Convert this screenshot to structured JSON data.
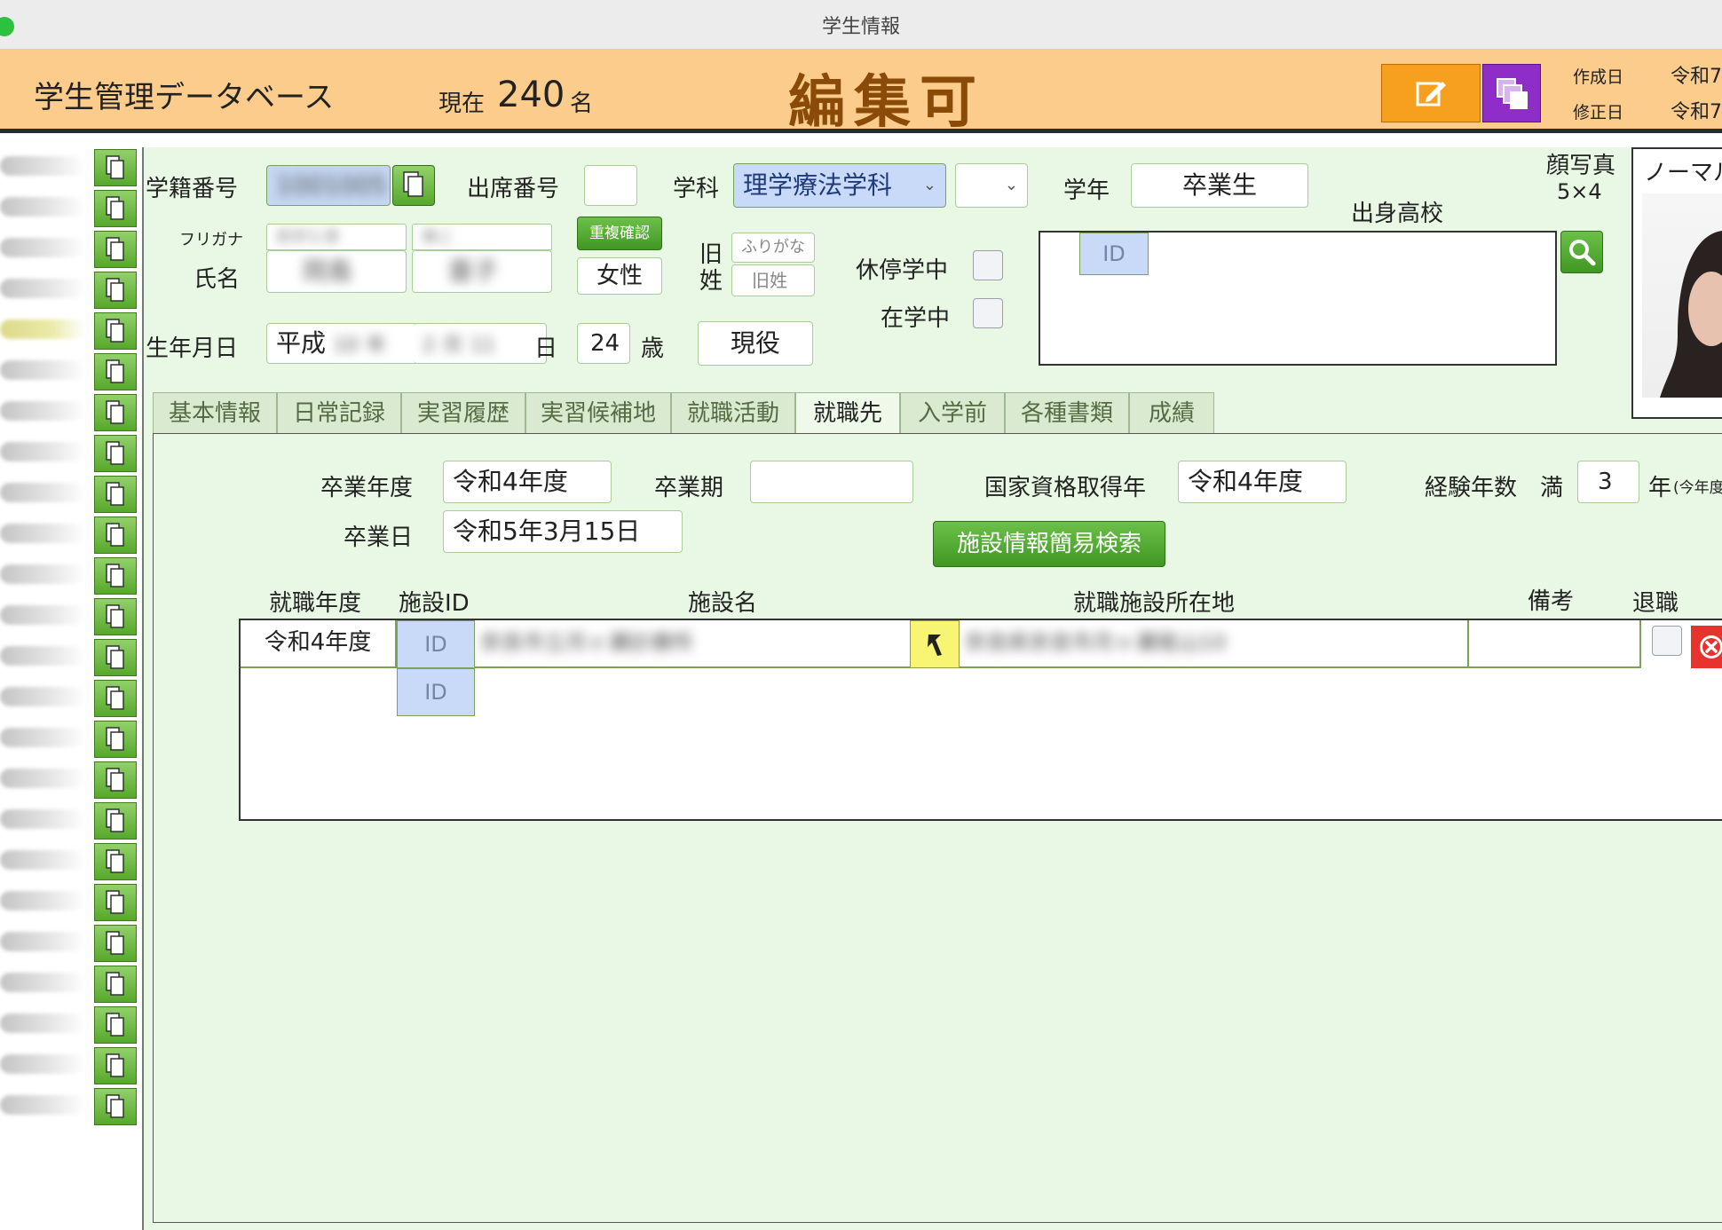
{
  "window": {
    "title": "学生情報"
  },
  "header": {
    "app_name": "学生管理データベース",
    "count_label": "現在",
    "count_value": "240",
    "count_unit": "名",
    "mode": "編集可",
    "created_label": "作成日",
    "modified_label": "修正日",
    "created_value": "令和7",
    "modified_value": "令和7"
  },
  "sidebar": {
    "rows": 24,
    "selected_index": 4
  },
  "form": {
    "student_no_label": "学籍番号",
    "student_no_value": "1001005",
    "attendance_no_label": "出席番号",
    "attendance_no_value": "",
    "department_label": "学科",
    "department_value": "理学療法学科",
    "department_sub_value": "",
    "grade_label": "学年",
    "grade_value": "卒業生",
    "photo_label": "顔写真",
    "photo_size": "5×4",
    "photo_mode": "ノーマル",
    "furigana_label": "フリガナ",
    "furigana_last": "おかじま",
    "furigana_first": "あこ",
    "name_label": "氏名",
    "name_last": "岡島",
    "name_first": "亜子",
    "dup_check_label": "重複確認",
    "gender_value": "女性",
    "old_surname_label": "旧姓",
    "old_kana_placeholder": "ふりがな",
    "old_name_placeholder": "旧姓",
    "leave_label": "休停学中",
    "enrolled_label": "在学中",
    "highschool_label": "出身高校",
    "highschool_id_label": "ID",
    "birth_label": "生年月日",
    "era_value": "平成",
    "birth_year": "10",
    "year_unit": "年",
    "birth_month": "2",
    "month_unit": "月",
    "birth_day": "11",
    "day_unit": "日",
    "age_value": "24",
    "age_unit": "歳",
    "status_value": "現役"
  },
  "tabs": [
    "基本情報",
    "日常記録",
    "実習履歴",
    "実習候補地",
    "就職活動",
    "就職先",
    "入学前",
    "各種書類",
    "成績"
  ],
  "active_tab": 5,
  "employment": {
    "grad_year_label": "卒業年度",
    "grad_year_value": "令和4年度",
    "grad_term_label": "卒業期",
    "grad_term_value": "",
    "license_year_label": "国家資格取得年",
    "license_year_value": "令和4年度",
    "experience_label": "経験年数",
    "experience_prefix": "満",
    "experience_value": "3",
    "experience_unit": "年",
    "experience_note": "(今年度",
    "grad_date_label": "卒業日",
    "grad_date_value": "令和5年3月15日",
    "facility_search_label": "施設情報簡易検索",
    "columns": {
      "year": "就職年度",
      "facility_id": "施設ID",
      "facility_name": "施設名",
      "address": "就職施設所在地",
      "notes": "備考",
      "retired": "退職"
    },
    "rows": [
      {
        "year": "令和4年度",
        "id_label": "ID",
        "facility_name": "奈良市立月ヶ瀬診療所",
        "address": "奈良県奈良市月ヶ瀬尾山10",
        "notes": ""
      }
    ],
    "new_row_id_label": "ID"
  },
  "colors": {
    "header_bg": "#fccc8c",
    "form_bg": "#e9f8e4",
    "mode_text": "#8a4a08",
    "edit_btn": "#f7a020",
    "copy_btn": "#8e2dc7",
    "green_btn": "#4ea52a",
    "id_cell": "#c9daf8"
  }
}
